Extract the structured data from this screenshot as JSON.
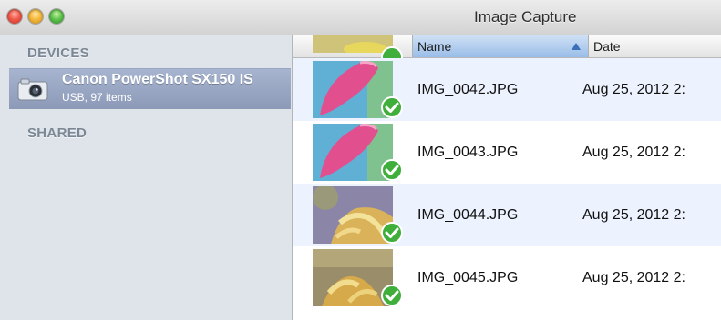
{
  "window": {
    "title": "Image Capture"
  },
  "sidebar": {
    "devices_header": "DEVICES",
    "shared_header": "SHARED",
    "device": {
      "name": "Canon PowerShot SX150 IS",
      "subtitle": "USB, 97 items",
      "icon": "camera-icon"
    }
  },
  "list": {
    "columns": {
      "name": "Name",
      "date": "Date"
    },
    "sort": {
      "column": "name",
      "direction": "ascending"
    },
    "rows": [
      {
        "name": "IMG_0042.JPG",
        "date": "Aug 25, 2012 2:",
        "imported": true
      },
      {
        "name": "IMG_0043.JPG",
        "date": "Aug 25, 2012 2:",
        "imported": true
      },
      {
        "name": "IMG_0044.JPG",
        "date": "Aug 25, 2012 2:",
        "imported": true
      },
      {
        "name": "IMG_0045.JPG",
        "date": "Aug 25, 2012 2:",
        "imported": true
      }
    ]
  },
  "colors": {
    "sidebar_bg": "#dfe4ea",
    "selection": "#8c9ab8",
    "row_alt": "#edf3fe",
    "check_green": "#3fae3a"
  }
}
